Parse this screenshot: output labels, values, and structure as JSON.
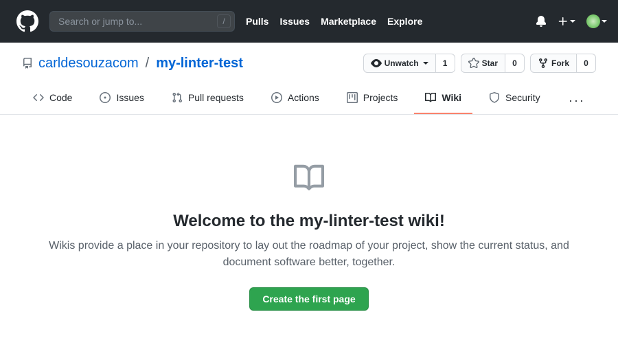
{
  "header": {
    "search_placeholder": "Search or jump to...",
    "nav": [
      "Pulls",
      "Issues",
      "Marketplace",
      "Explore"
    ]
  },
  "repo": {
    "owner": "carldesouzacom",
    "name": "my-linter-test",
    "actions": {
      "unwatch": {
        "label": "Unwatch",
        "count": "1"
      },
      "star": {
        "label": "Star",
        "count": "0"
      },
      "fork": {
        "label": "Fork",
        "count": "0"
      }
    }
  },
  "tabs": {
    "code": "Code",
    "issues": "Issues",
    "pulls": "Pull requests",
    "actions": "Actions",
    "projects": "Projects",
    "wiki": "Wiki",
    "security": "Security"
  },
  "wiki": {
    "heading": "Welcome to the my-linter-test wiki!",
    "description": "Wikis provide a place in your repository to lay out the roadmap of your project, show the current status, and document software better, together.",
    "cta": "Create the first page"
  }
}
